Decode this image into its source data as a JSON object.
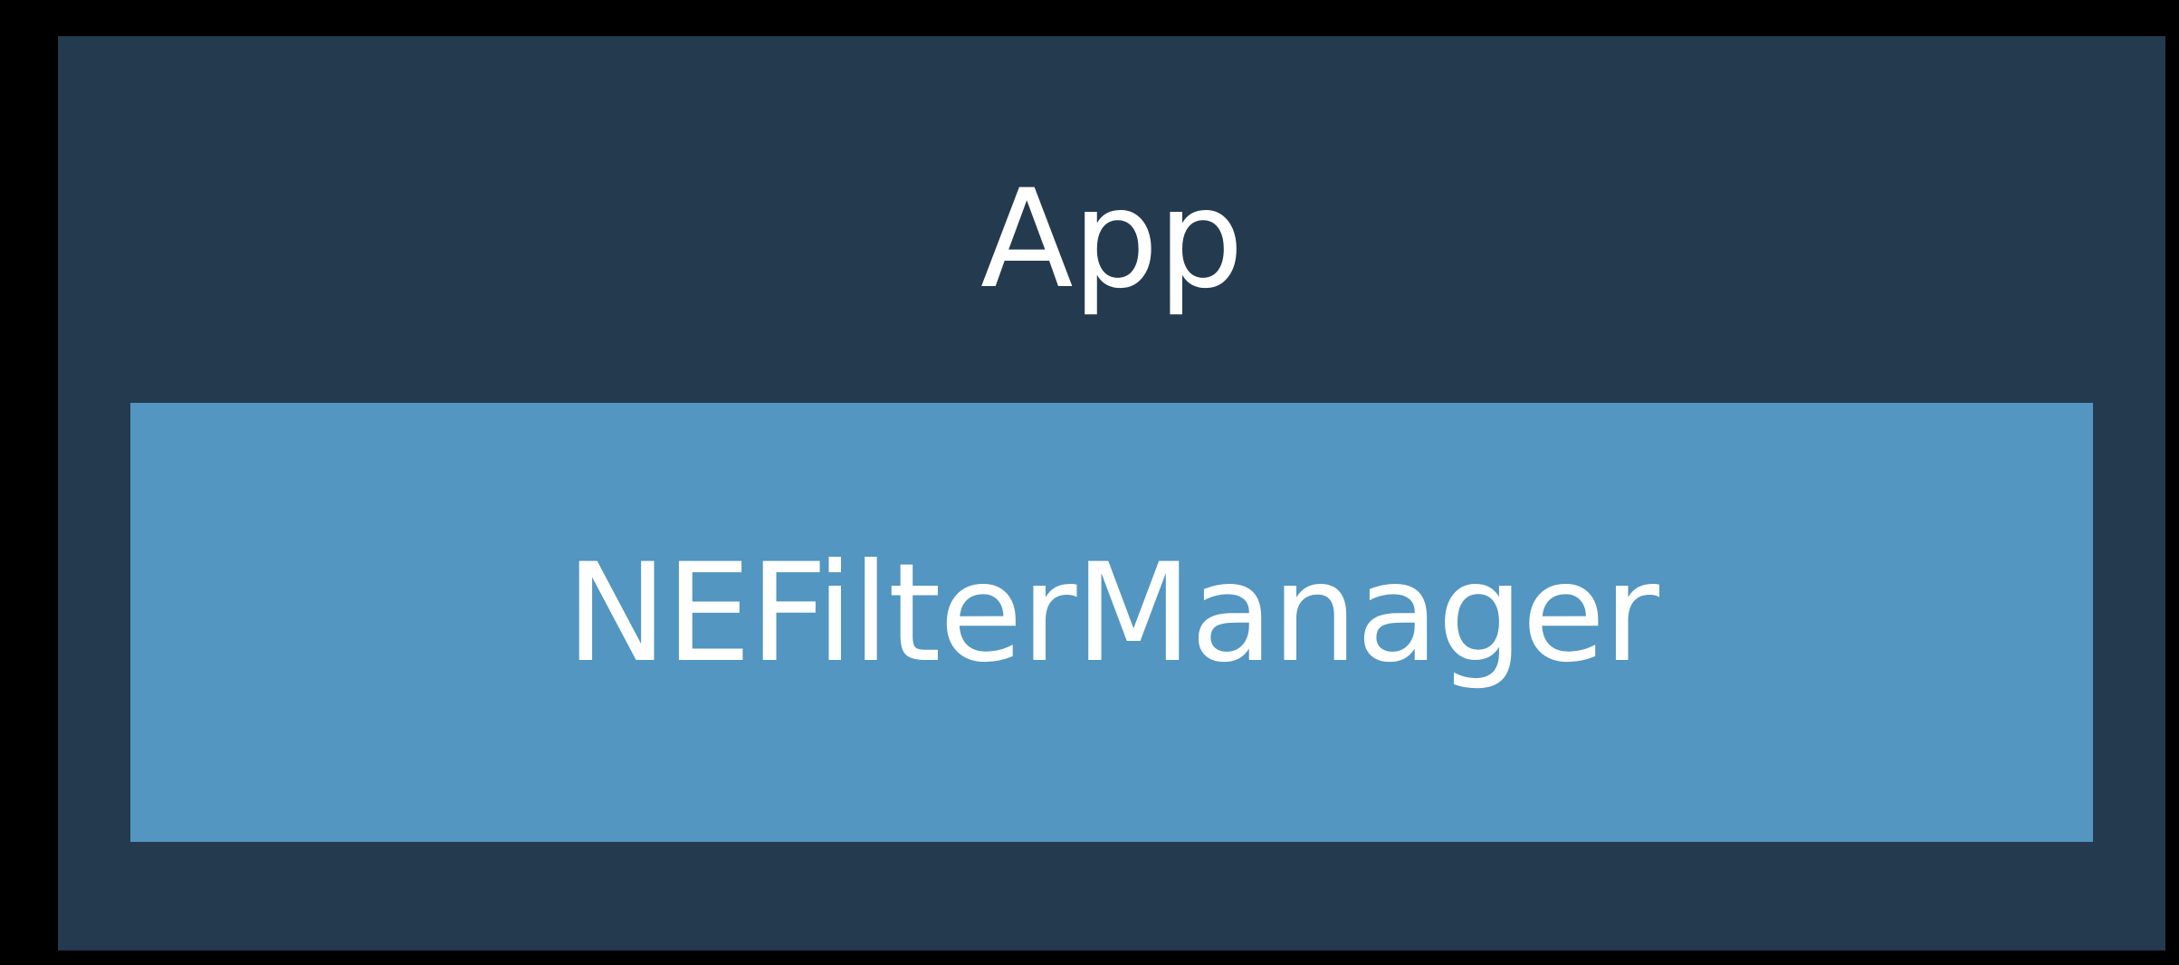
{
  "diagram": {
    "outer_box": {
      "label": "App",
      "color": "#243a4f"
    },
    "inner_box": {
      "label": "NEFilterManager",
      "color": "#5296c1"
    },
    "text_color": "#ffffff",
    "background_color": "#000000"
  }
}
